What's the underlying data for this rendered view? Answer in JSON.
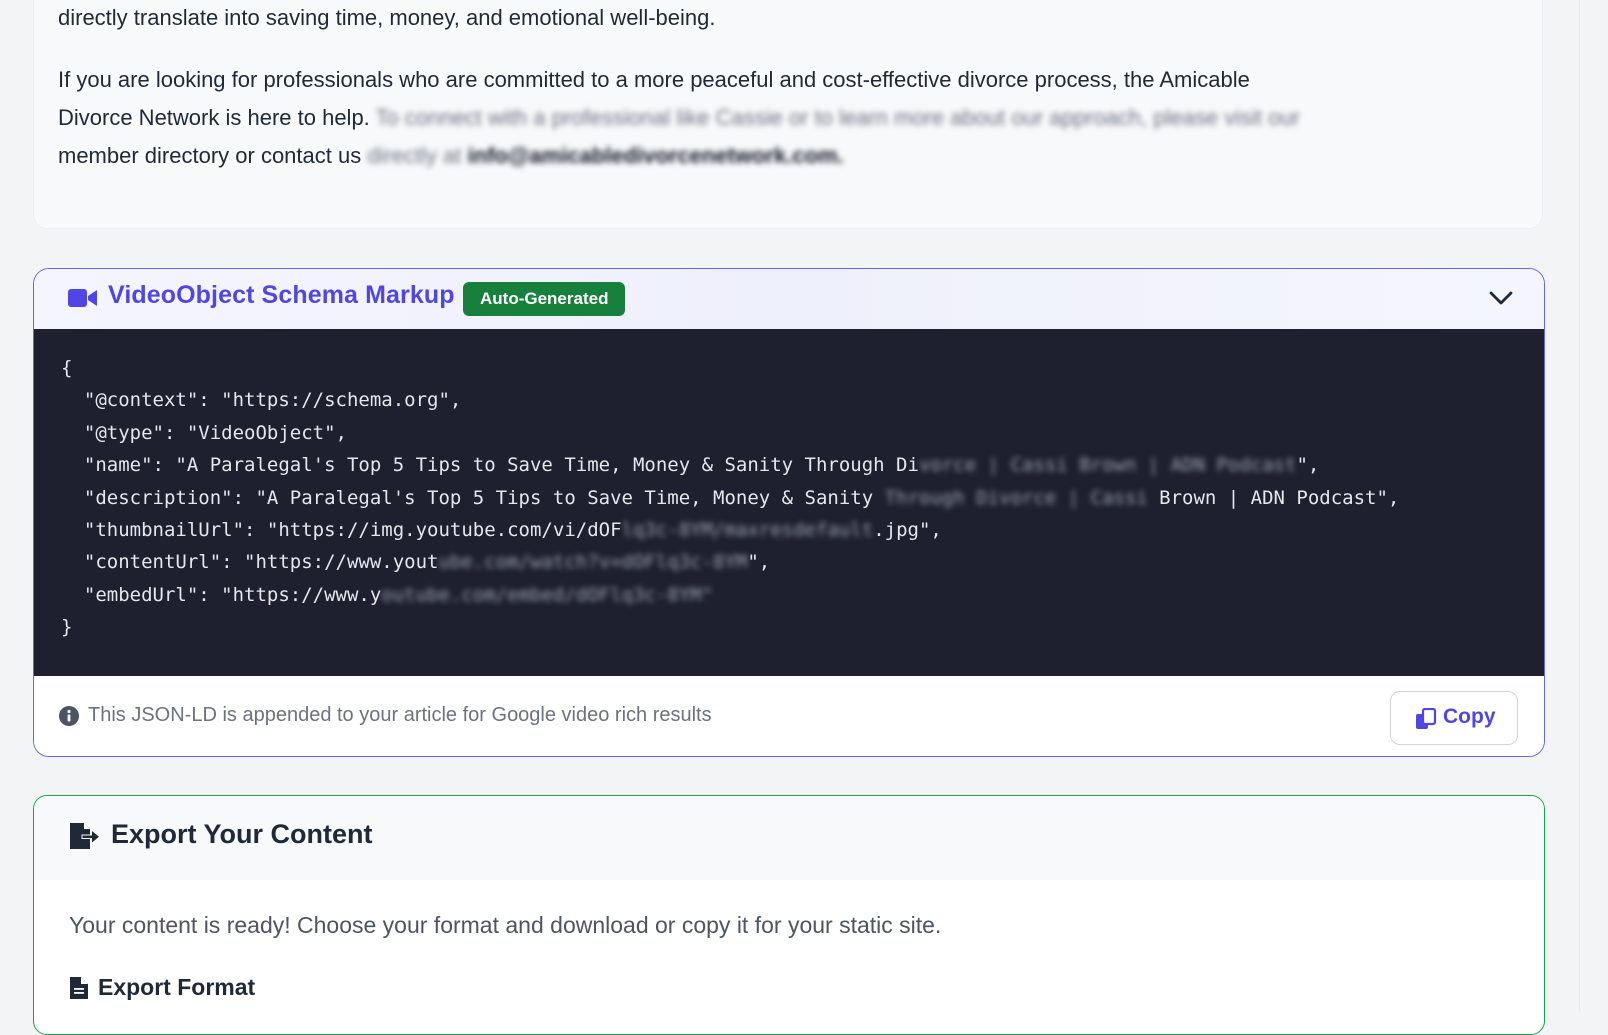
{
  "article": {
    "p1": "directly translate into saving time, money, and emotional well-being.",
    "p2_line1": "If you are looking for professionals who are committed to a more peaceful and cost-effective divorce process, the Amicable",
    "p2_line2_start": "Divorce Network is here to help.",
    "p2_line2_blur": "To connect with a professional like Cassie or to learn more about our approach, please visit our",
    "p2_line3_start": "member directory or contact us",
    "p2_line3_blur": "directly at",
    "p2_email": "info@amicabledivorcenetwork.com."
  },
  "schema": {
    "title": "VideoObject Schema Markup",
    "badge": "Auto-Generated",
    "code": {
      "open": "{",
      "l1": "  \"@context\": \"https://schema.org\",",
      "l2": "  \"@type\": \"VideoObject\",",
      "l3a": "  \"name\": \"A Paralegal's Top 5 Tips to Save Time, Money & Sanity Through Di",
      "l3b": "vorce | Cassi Brown | ADN Podcast",
      "l3c": "\",",
      "l4a": "  \"description\": \"A Paralegal's Top 5 Tips to Save Time, Money & Sanity ",
      "l4b": "Through Divorce | Cassi",
      "l4c": " Brown | ADN Podcast\",",
      "l5a": "  \"thumbnailUrl\": \"https://img.youtube.com/vi/dOF",
      "l5b": "lq3c-8YM/maxresdefault",
      "l5c": ".jpg\",",
      "l6a": "  \"contentUrl\": \"https://www.yout",
      "l6b": "ube.com/watch?v=dOFlq3c-8YM",
      "l6c": "\",",
      "l7a": "  \"embedUrl\": \"https://www.y",
      "l7b": "outube.com/embed/dOFlq3c-8YM\"",
      "close": "}"
    },
    "footer_text": "This JSON-LD is appended to your article for Google video rich results",
    "copy_label": "Copy"
  },
  "export": {
    "title": "Export Your Content",
    "description": "Your content is ready! Choose your format and download or copy it for your static site.",
    "format_label": "Export Format"
  },
  "colors": {
    "accent": "#4f46e5",
    "badge": "#16803c",
    "code_bg": "#1e1f2f",
    "export_border": "#16a34a"
  },
  "icons": [
    "video-icon",
    "chevron-down-icon",
    "info-icon",
    "copy-icon",
    "file-export-icon",
    "file-icon"
  ]
}
